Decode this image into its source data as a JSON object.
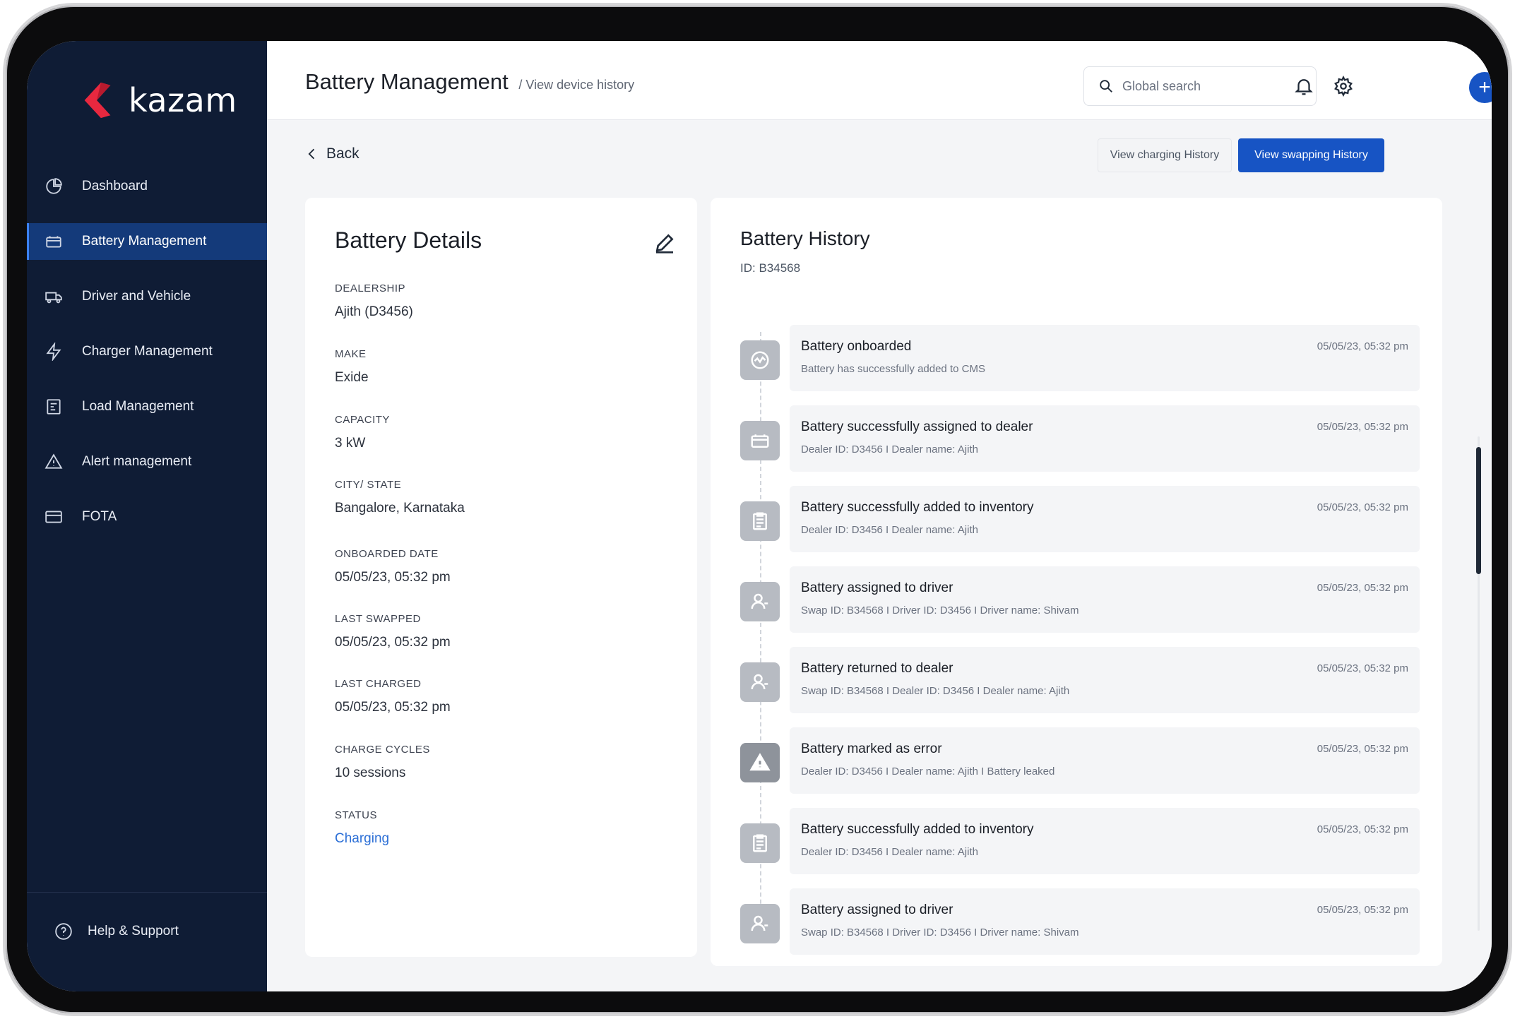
{
  "app": {
    "logo_text": "kazam",
    "brand_color": "#e8283f",
    "accent_color": "#1754c4"
  },
  "sidebar": {
    "items": [
      {
        "label": "Dashboard",
        "icon": "pie-chart-icon"
      },
      {
        "label": "Battery Management",
        "icon": "battery-icon",
        "active": true
      },
      {
        "label": "Driver and Vehicle",
        "icon": "truck-icon"
      },
      {
        "label": "Charger Management",
        "icon": "lightning-icon"
      },
      {
        "label": "Load Management",
        "icon": "clipboard-icon"
      },
      {
        "label": "Alert management",
        "icon": "warning-icon"
      },
      {
        "label": "FOTA",
        "icon": "card-icon"
      }
    ],
    "help_label": "Help & Support"
  },
  "header": {
    "title": "Battery Management",
    "breadcrumb": "/ View device history",
    "search_placeholder": "Global search"
  },
  "toolbar": {
    "back_label": "Back",
    "charging_history_label": "View charging History",
    "swapping_history_label": "View swapping History"
  },
  "details": {
    "title": "Battery Details",
    "fields": [
      {
        "label": "DEALERSHIP",
        "value": "Ajith (D3456)"
      },
      {
        "label": "MAKE",
        "value": "Exide"
      },
      {
        "label": "CAPACITY",
        "value": "3 kW"
      },
      {
        "label": "CITY/ STATE",
        "value": "Bangalore, Karnataka"
      },
      {
        "label": "ONBOARDED DATE",
        "value": "05/05/23, 05:32 pm"
      },
      {
        "label": "LAST SWAPPED",
        "value": "05/05/23, 05:32 pm"
      },
      {
        "label": "LAST CHARGED",
        "value": "05/05/23, 05:32 pm"
      },
      {
        "label": "CHARGE CYCLES",
        "value": "10 sessions"
      },
      {
        "label": "STATUS",
        "value": "Charging"
      }
    ]
  },
  "history": {
    "title": "Battery History",
    "id_label": "ID: B34568",
    "events": [
      {
        "title": "Battery onboarded",
        "sub": "Battery has successfully added to CMS",
        "time": "05/05/23, 05:32 pm",
        "icon": "activity-icon"
      },
      {
        "title": "Battery successfully assigned to dealer",
        "sub": "Dealer ID: D3456  I  Dealer name: Ajith",
        "time": "05/05/23, 05:32 pm",
        "icon": "battery-icon"
      },
      {
        "title": "Battery successfully added to inventory",
        "sub": "Dealer ID: D3456  I  Dealer name: Ajith",
        "time": "05/05/23, 05:32 pm",
        "icon": "clipboard-icon"
      },
      {
        "title": "Battery assigned to driver",
        "sub": "Swap ID: B34568  I  Driver ID: D3456  I  Driver name: Shivam",
        "time": "05/05/23, 05:32 pm",
        "icon": "user-icon"
      },
      {
        "title": "Battery returned to dealer",
        "sub": "Swap ID: B34568  I  Dealer ID: D3456  I  Dealer name: Ajith",
        "time": "05/05/23, 05:32 pm",
        "icon": "user-icon"
      },
      {
        "title": "Battery marked as error",
        "sub": "Dealer ID: D3456 I Dealer name: Ajith I Battery leaked",
        "time": "05/05/23, 05:32 pm",
        "icon": "warning-icon"
      },
      {
        "title": "Battery successfully added to inventory",
        "sub": "Dealer ID: D3456  I  Dealer name: Ajith",
        "time": "05/05/23, 05:32 pm",
        "icon": "clipboard-icon"
      },
      {
        "title": "Battery assigned to driver",
        "sub": "Swap ID: B34568  I  Driver ID: D3456  I  Driver name: Shivam",
        "time": "05/05/23, 05:32 pm",
        "icon": "user-icon"
      }
    ]
  }
}
